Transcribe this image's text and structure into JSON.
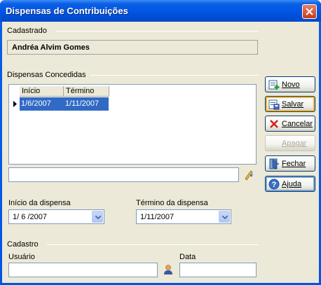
{
  "window": {
    "title": "Dispensas de Contribuições"
  },
  "cadastrado": {
    "group_label": "Cadastrado",
    "name": "Andréa Alvim Gomes"
  },
  "dispensas": {
    "group_label": "Dispensas Concedidas",
    "columns": [
      "Início",
      "Término"
    ],
    "rows": [
      {
        "inicio": "1/6/2007",
        "termino": "1/11/2007"
      }
    ],
    "note_value": ""
  },
  "buttons": {
    "novo": "Novo",
    "salvar": "Salvar",
    "cancelar": "Cancelar",
    "apagar": "Apagar",
    "fechar": "Fechar",
    "ajuda": "Ajuda"
  },
  "inicio_dispensa": {
    "label": "Início da dispensa",
    "value": "1/ 6 /2007"
  },
  "termino_dispensa": {
    "label": "Término da dispensa",
    "value": "1/11/2007"
  },
  "cadastro": {
    "group_label": "Cadastro",
    "usuario_label": "Usuário",
    "usuario_value": "",
    "data_label": "Data",
    "data_value": ""
  },
  "icons": [
    "close-icon",
    "novo-icon",
    "salvar-icon",
    "cancelar-icon",
    "apagar-icon",
    "fechar-icon",
    "ajuda-icon",
    "lookup-icon",
    "user-icon",
    "row-indicator-icon"
  ]
}
